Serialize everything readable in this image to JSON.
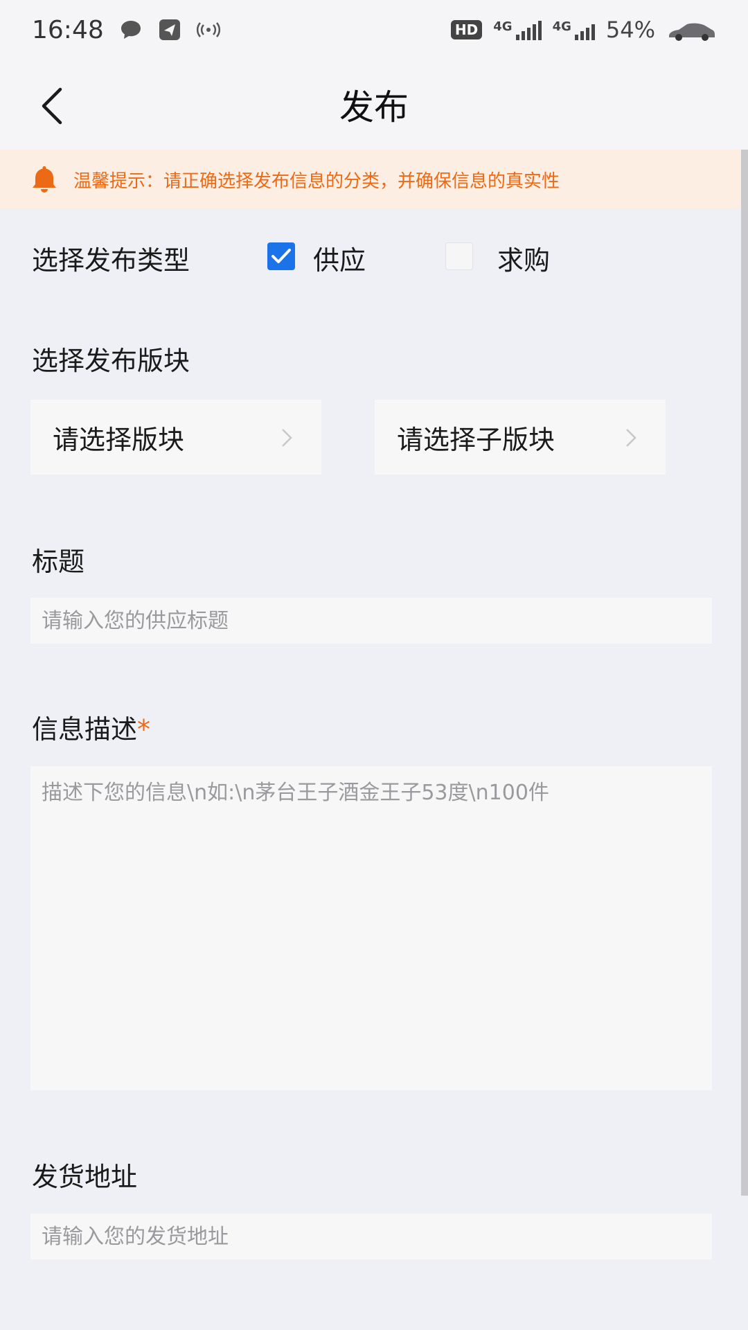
{
  "status_bar": {
    "time": "16:48",
    "net_1": "4G",
    "net_2": "4G",
    "hd_badge": "HD",
    "battery": "54%"
  },
  "header": {
    "title": "发布"
  },
  "notice": {
    "text": "温馨提示：请正确选择发布信息的分类，并确保信息的真实性",
    "color": "#ec6a16"
  },
  "publish_type": {
    "label": "选择发布类型",
    "options": [
      {
        "label": "供应",
        "checked": true
      },
      {
        "label": "求购",
        "checked": false
      }
    ]
  },
  "section": {
    "label": "选择发布版块",
    "board_placeholder": "请选择版块",
    "sub_board_placeholder": "请选择子版块"
  },
  "title_field": {
    "label": "标题",
    "placeholder": "请输入您的供应标题"
  },
  "description_field": {
    "label": "信息描述",
    "required_mark": "*",
    "placeholder": "描述下您的信息\\n如:\\n茅台王子酒金王子53度\\n100件"
  },
  "address_field": {
    "label": "发货地址",
    "placeholder": "请输入您的发货地址"
  },
  "colors": {
    "accent": "#1a73e8",
    "warning": "#ec6a16",
    "background": "#eef0f5"
  }
}
